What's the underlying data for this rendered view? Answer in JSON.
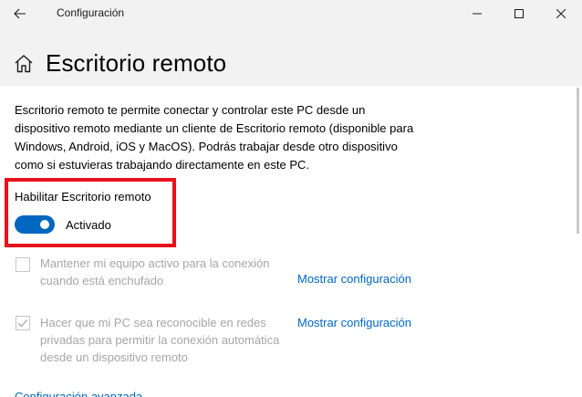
{
  "window": {
    "app_title": "Configuración",
    "back_icon": "arrow-left-icon",
    "minimize_icon": "minimize-icon",
    "maximize_icon": "maximize-icon",
    "close_icon": "close-icon"
  },
  "header": {
    "icon": "home-icon",
    "title": "Escritorio remoto"
  },
  "main": {
    "description": "Escritorio remoto te permite conectar y controlar este PC desde un dispositivo remoto mediante un cliente de Escritorio remoto (disponible para Windows, Android, iOS y MacOS). Podrás trabajar desde otro dispositivo como si estuvieras trabajando directamente en este PC.",
    "enable_toggle": {
      "label": "Habilitar Escritorio remoto",
      "state_text": "Activado",
      "on": true,
      "color": "#0067c0"
    },
    "highlight_color": "#e8111b",
    "options": [
      {
        "text": "Mantener mi equipo activo para la conexión cuando está enchufado",
        "checked": false,
        "link": "Mostrar configuración"
      },
      {
        "text": "Hacer que mi PC sea reconocible en redes privadas para permitir la conexión automática desde un dispositivo remoto",
        "checked": true,
        "link": "Mostrar configuración"
      }
    ],
    "advanced_link": "Configuración avanzada"
  }
}
